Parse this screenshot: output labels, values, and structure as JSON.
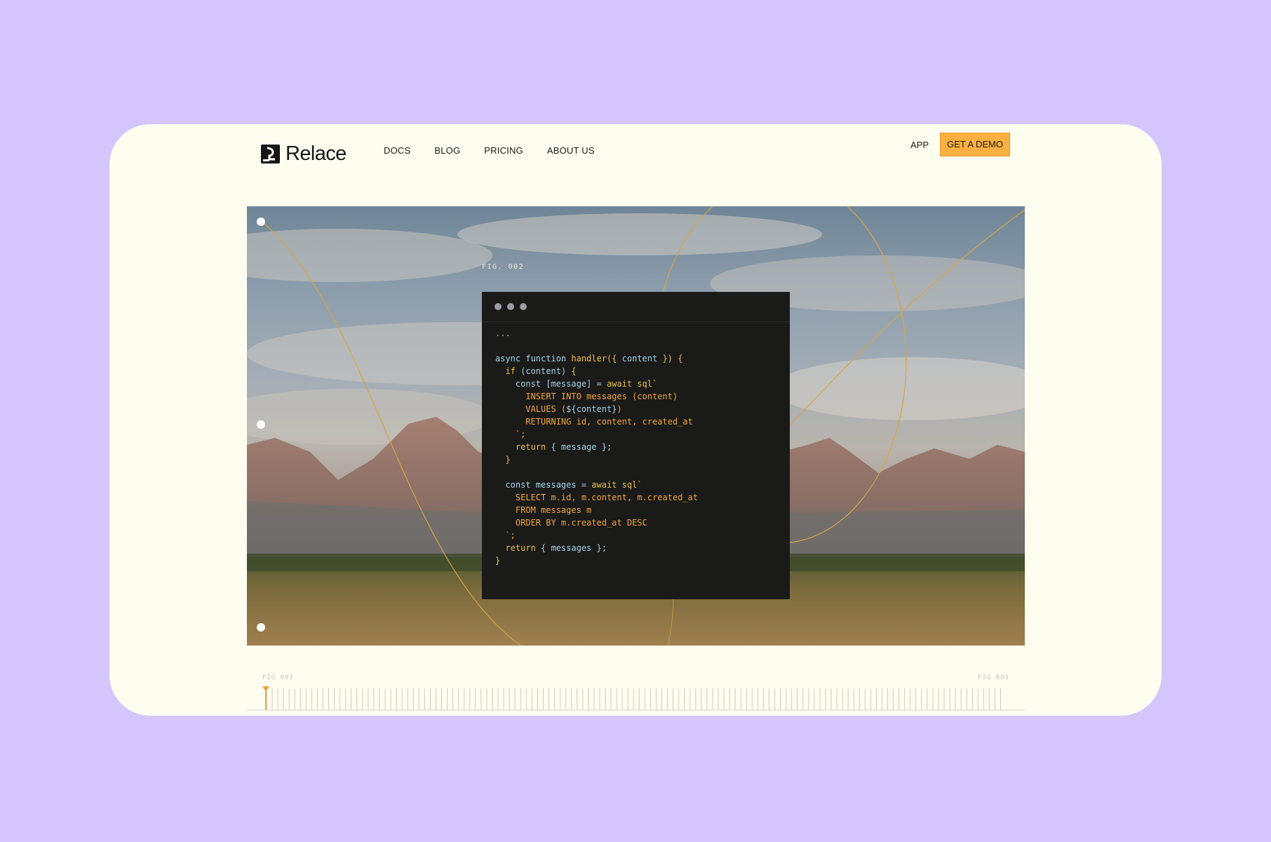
{
  "nav": {
    "logo_text": "Relace",
    "links": [
      "DOCS",
      "BLOG",
      "PRICING",
      "ABOUT US"
    ],
    "app_label": "APP",
    "demo_label": "GET A DEMO"
  },
  "hero": {
    "figure_label": "FIG. 002",
    "code_lines": [
      [
        [
          "...",
          "dim"
        ]
      ],
      [],
      [
        [
          "async function ",
          "kw"
        ],
        [
          "handler",
          "fn"
        ],
        [
          "({ ",
          "yl"
        ],
        [
          "content",
          "kw"
        ],
        [
          " }) {",
          "yl"
        ]
      ],
      [
        [
          "  if ",
          "yl"
        ],
        [
          "(content) ",
          "kw"
        ],
        [
          "{",
          "yl"
        ]
      ],
      [
        [
          "    const [message] = ",
          "kw"
        ],
        [
          "await sql`",
          "yl"
        ]
      ],
      [
        [
          "      INSERT INTO messages (content)",
          "or"
        ]
      ],
      [
        [
          "      VALUES (",
          "or"
        ],
        [
          "${content}",
          "kw"
        ],
        [
          ")",
          "or"
        ]
      ],
      [
        [
          "      RETURNING id, content, created_at",
          "or"
        ]
      ],
      [
        [
          "    `;",
          "or"
        ]
      ],
      [
        [
          "    return ",
          "yl"
        ],
        [
          "{ message };",
          "kw"
        ]
      ],
      [
        [
          "  }",
          "yl"
        ]
      ],
      [],
      [
        [
          "  const messages = ",
          "kw"
        ],
        [
          "await sql`",
          "yl"
        ]
      ],
      [
        [
          "    SELECT m.id, m.content, m.created_at",
          "or"
        ]
      ],
      [
        [
          "    FROM messages m",
          "or"
        ]
      ],
      [
        [
          "    ORDER BY m.created_at DESC",
          "or"
        ]
      ],
      [
        [
          "  `;",
          "or"
        ]
      ],
      [
        [
          "  return ",
          "yl"
        ],
        [
          "{ messages };",
          "kw"
        ]
      ],
      [
        [
          "}",
          "yl"
        ]
      ]
    ]
  },
  "timeline": {
    "left_label": "FIG 001",
    "right_label": "FIG 003"
  },
  "colors": {
    "background": "#d4c6fd",
    "frame": "#fdfdf0",
    "accent": "#fbb03f",
    "code_bg": "#1a1a18"
  }
}
